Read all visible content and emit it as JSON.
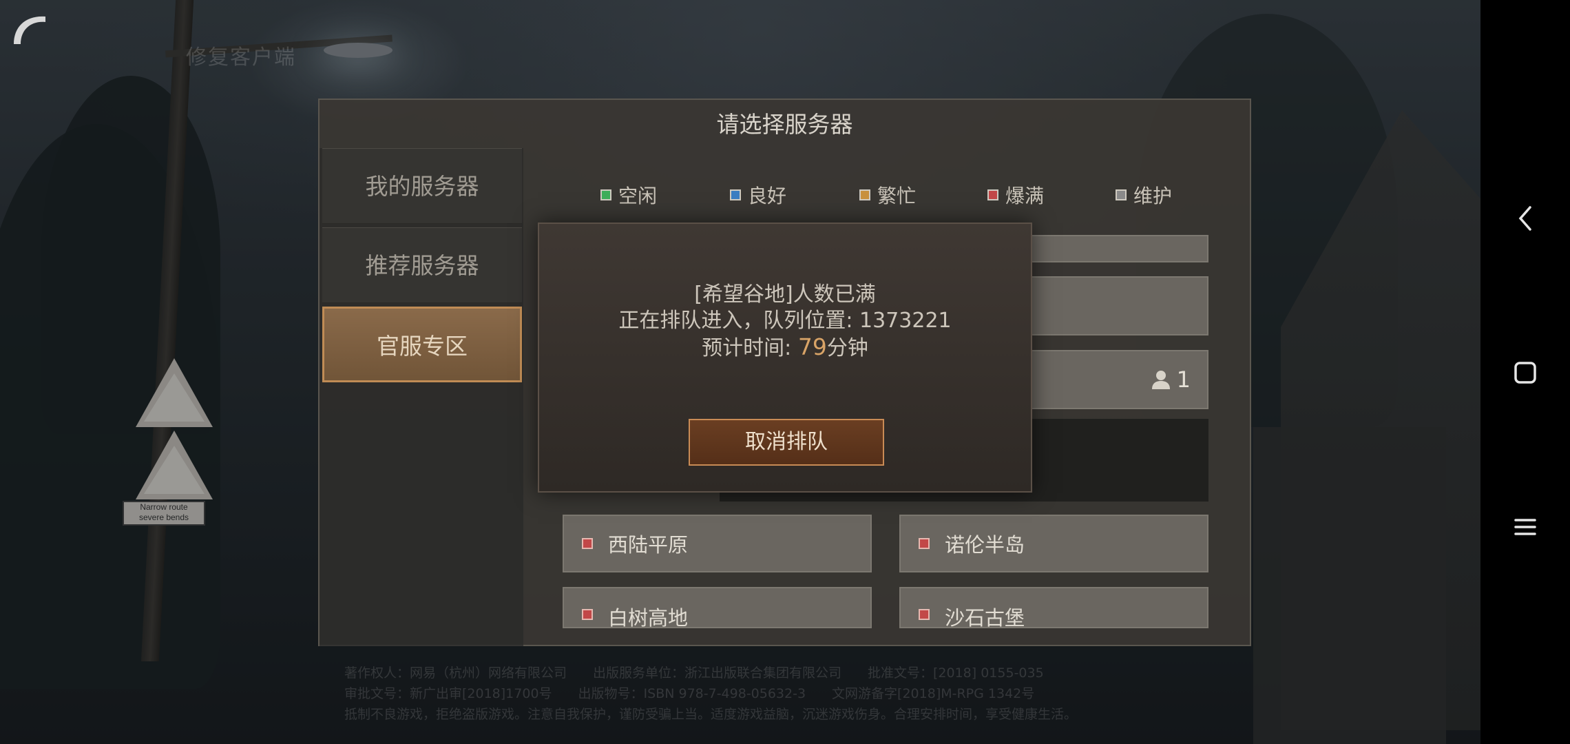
{
  "header": {
    "client_label": "修复客户端"
  },
  "panel": {
    "title": "请选择服务器",
    "tabs": [
      {
        "label": "我的服务器"
      },
      {
        "label": "推荐服务器"
      },
      {
        "label": "官服专区",
        "selected": true
      }
    ]
  },
  "legend": [
    {
      "label": "空闲",
      "color": "#3fae5a"
    },
    {
      "label": "良好",
      "color": "#3b7ec2"
    },
    {
      "label": "繁忙",
      "color": "#c9913e"
    },
    {
      "label": "爆满",
      "color": "#c24848"
    },
    {
      "label": "维护",
      "color": "#8a8a8a"
    }
  ],
  "servers": {
    "hidden_count": "1",
    "list": [
      {
        "name": "西陆平原",
        "status": "爆满"
      },
      {
        "name": "诺伦半岛",
        "status": "爆满"
      },
      {
        "name": "白树高地",
        "status": "爆满"
      },
      {
        "name": "沙石古堡",
        "status": "爆满"
      }
    ]
  },
  "dialog": {
    "line1": "[希望谷地]人数已满",
    "line2_prefix": "正在排队进入，队列位置: ",
    "queue_position": "1373221",
    "line3_prefix": "预计时间: ",
    "eta_value": "79",
    "eta_unit": "分钟",
    "cancel_label": "取消排队",
    "accent_color": "#d9a467"
  },
  "scene": {
    "sign_line1": "Narrow route",
    "sign_line2": "severe bends"
  },
  "footer": {
    "line1": "著作权人：网易（杭州）网络有限公司　　出版服务单位：浙江出版联合集团有限公司　　批准文号：[2018] 0155-035",
    "line2": "审批文号：新广出审[2018]1700号　　出版物号：ISBN 978-7-498-05632-3　　文网游备字[2018]M-RPG 1342号",
    "line3": "抵制不良游戏，拒绝盗版游戏。注意自我保护，谨防受骗上当。适度游戏益脑，沉迷游戏伤身。合理安排时间，享受健康生活。"
  }
}
